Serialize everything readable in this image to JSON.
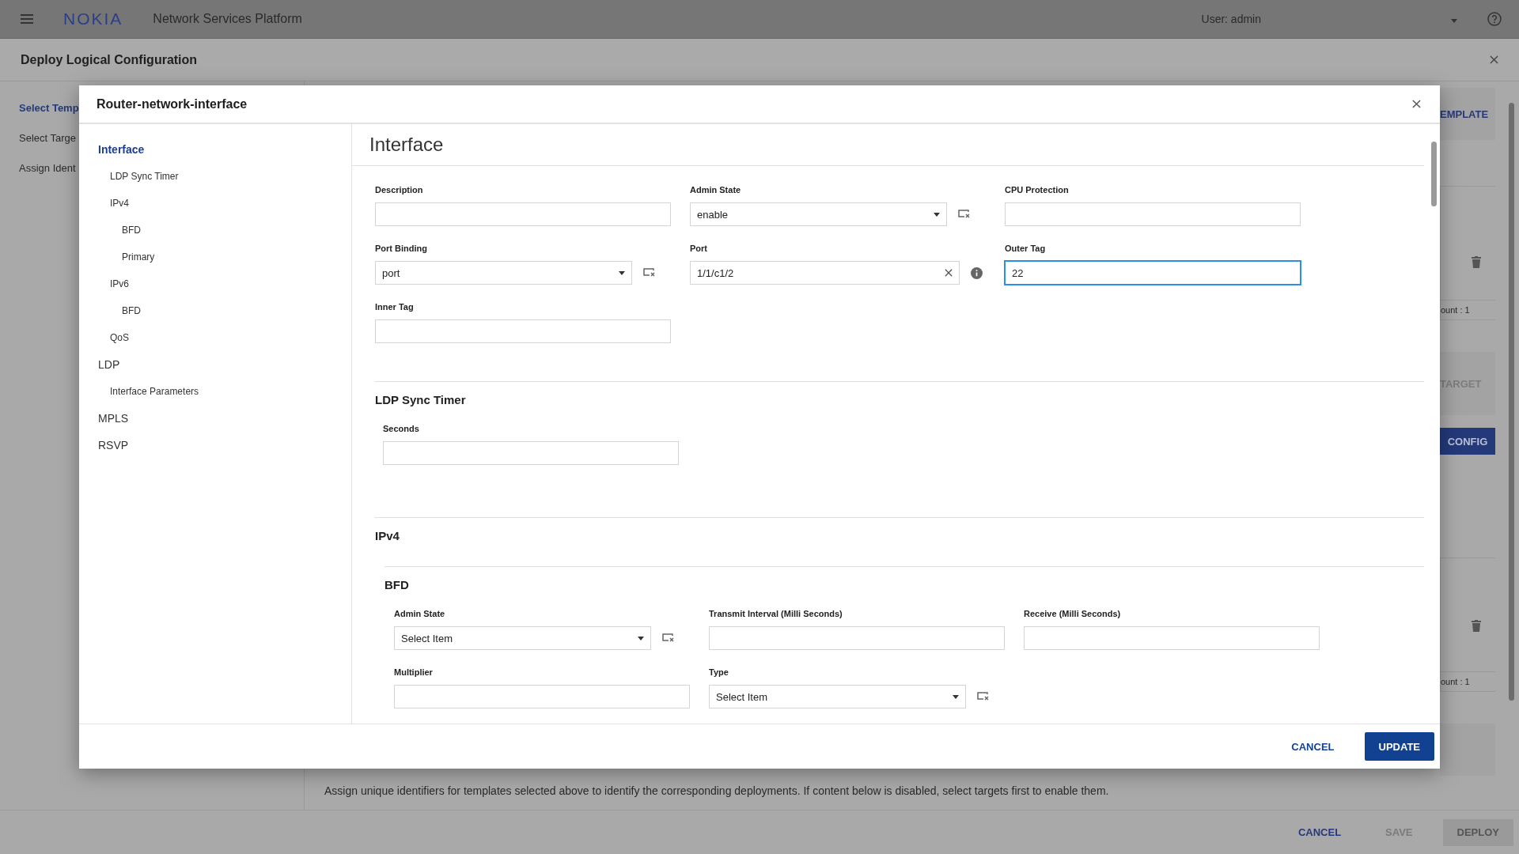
{
  "app": {
    "logo": "NOKIA",
    "title": "Network Services Platform",
    "user": "User: admin"
  },
  "page": {
    "title": "Deploy Logical Configuration",
    "steps": [
      {
        "label": "Select Temp",
        "selected": true
      },
      {
        "label": "Select Targe",
        "selected": false
      },
      {
        "label": "Assign Ident",
        "selected": false
      }
    ],
    "side_panels": [
      {
        "kind": "band",
        "label": "EMPLATE",
        "active": true
      },
      {
        "kind": "table",
        "footer": "ount : 1"
      },
      {
        "kind": "band",
        "label": "TARGET",
        "active": false
      },
      {
        "kind": "button",
        "label": "CONFIG"
      },
      {
        "kind": "table",
        "footer": "ount : 1"
      },
      {
        "kind": "blank"
      }
    ],
    "description": "Assign unique identifiers for templates selected above to identify the corresponding deployments. If content below is disabled, select targets first to enable them.",
    "footer": [
      {
        "label": "CANCEL",
        "disabled": false,
        "kind": "link"
      },
      {
        "label": "SAVE",
        "disabled": true,
        "kind": "link"
      },
      {
        "label": "DEPLOY",
        "disabled": true,
        "kind": "button"
      }
    ]
  },
  "dialog": {
    "title": "Router-network-interface",
    "nav": [
      {
        "label": "Interface",
        "selected": true,
        "children": [
          {
            "label": "LDP Sync Timer",
            "selected": false
          },
          {
            "label": "IPv4",
            "selected": false,
            "children": [
              {
                "label": "BFD",
                "selected": false
              },
              {
                "label": "Primary",
                "selected": false
              }
            ]
          },
          {
            "label": "IPv6",
            "selected": false,
            "children": [
              {
                "label": "BFD",
                "selected": false
              }
            ]
          },
          {
            "label": "QoS",
            "selected": false
          }
        ]
      },
      {
        "label": "LDP",
        "selected": false,
        "children": [
          {
            "label": "Interface Parameters",
            "selected": false
          }
        ]
      },
      {
        "label": "MPLS",
        "selected": false
      },
      {
        "label": "RSVP",
        "selected": false
      }
    ],
    "heading": "Interface",
    "fields": [
      {
        "label": "Description",
        "kind": "text",
        "focused": false
      },
      {
        "label": "Admin State",
        "kind": "select",
        "value": "enable",
        "focused": false
      },
      {
        "label": "CPU Protection",
        "kind": "text",
        "focused": false
      },
      {
        "label": "Port Binding",
        "kind": "select",
        "value": "port",
        "focused": false
      },
      {
        "label": "Port",
        "kind": "lookup",
        "value": "1/1/c1/2",
        "focused": false
      },
      {
        "label": "Outer Tag",
        "kind": "text",
        "value": "22",
        "focused": true
      },
      {
        "label": "Inner Tag",
        "kind": "text",
        "focused": false
      }
    ],
    "sections": [
      {
        "title": "LDP Sync Timer",
        "fields": [
          {
            "label": "Seconds",
            "kind": "text",
            "focused": false
          }
        ]
      },
      {
        "title": "IPv4",
        "children": [
          {
            "title": "BFD",
            "fields": [
              {
                "label": "Admin State",
                "kind": "select",
                "value": "Select Item",
                "focused": false
              },
              {
                "label": "Transmit Interval (Milli Seconds)",
                "kind": "text",
                "focused": false
              },
              {
                "label": "Receive (Milli Seconds)",
                "kind": "text",
                "focused": false
              },
              {
                "label": "Multiplier",
                "kind": "text",
                "focused": false
              },
              {
                "label": "Type",
                "kind": "select",
                "value": "Select Item",
                "focused": false
              }
            ]
          }
        ]
      }
    ],
    "buttons": [
      {
        "label": "CANCEL",
        "kind": "link"
      },
      {
        "label": "UPDATE",
        "kind": "primary"
      }
    ]
  }
}
